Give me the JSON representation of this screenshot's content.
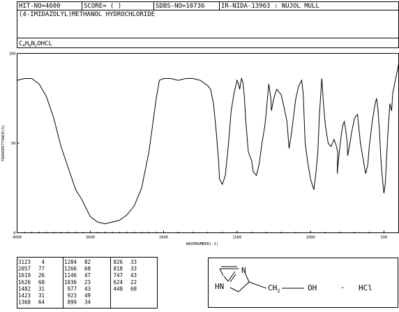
{
  "header": {
    "hit_no": "HIT-NO=4600",
    "score": "SCORE=  (   )",
    "sdbs_no": "SDBS-NO=10736",
    "method": "IR-NIDA-13963 : NUJOL MULL",
    "compound_name": "(4-IMIDAZOLYL)METHANOL HYDROCHLORIDE",
    "formula_prefix": "C",
    "formula_sub1": "4",
    "formula_mid1": "H",
    "formula_sub2": "8",
    "formula_mid2": "N",
    "formula_sub3": "2",
    "formula_mid3": "O",
    "formula_suffix": "HCL"
  },
  "chart_data": {
    "type": "line",
    "xlabel": "WAVENUMBER(-1)",
    "ylabel": "TRANSMITTANCE(%)",
    "x_reversed": true,
    "xlim": [
      4000,
      400
    ],
    "ylim": [
      0,
      100
    ],
    "x_ticks": [
      "4000",
      "3000",
      "2000",
      "1500",
      "1000",
      "500"
    ],
    "y_ticks": [
      "100",
      "50",
      "0"
    ],
    "series": [
      {
        "x": [
          4000,
          3900,
          3800,
          3700,
          3600,
          3500,
          3400,
          3300,
          3200,
          3123,
          3050,
          3000,
          2900,
          2800,
          2700,
          2600,
          2500,
          2400,
          2300,
          2200,
          2100,
          2057,
          2000,
          1950,
          1900,
          1850,
          1800,
          1750,
          1700,
          1680,
          1660,
          1640,
          1626,
          1619,
          1600,
          1580,
          1560,
          1540,
          1520,
          1500,
          1490,
          1482,
          1470,
          1460,
          1450,
          1440,
          1423,
          1400,
          1390,
          1368,
          1350,
          1330,
          1310,
          1300,
          1284,
          1270,
          1266,
          1250,
          1230,
          1200,
          1180,
          1160,
          1146,
          1130,
          1100,
          1080,
          1060,
          1050,
          1036,
          1020,
          1000,
          985,
          977,
          965,
          950,
          940,
          923,
          910,
          899,
          880,
          860,
          840,
          826,
          815,
          818,
          810,
          800,
          790,
          780,
          770,
          760,
          750,
          747,
          735,
          720,
          700,
          680,
          660,
          640,
          624,
          610,
          600,
          580,
          560,
          550,
          540,
          530,
          520,
          510,
          500,
          490,
          480,
          470,
          460,
          448,
          440,
          430,
          420,
          410,
          400
        ],
        "y": [
          85,
          86,
          86,
          83,
          76,
          64,
          48,
          36,
          24,
          19,
          13,
          9,
          6,
          5,
          6,
          7,
          10,
          15,
          25,
          45,
          75,
          85,
          86,
          86,
          85,
          86,
          86,
          85,
          82,
          80,
          72,
          55,
          40,
          30,
          27,
          32,
          48,
          68,
          78,
          85,
          83,
          80,
          86,
          84,
          76,
          62,
          45,
          40,
          34,
          32,
          38,
          50,
          60,
          68,
          83,
          75,
          68,
          75,
          80,
          77,
          70,
          62,
          47,
          55,
          75,
          82,
          85,
          78,
          50,
          40,
          30,
          26,
          24,
          32,
          45,
          65,
          86,
          70,
          60,
          50,
          48,
          52,
          49,
          45,
          33,
          40,
          48,
          55,
          60,
          62,
          57,
          50,
          43,
          48,
          56,
          64,
          66,
          50,
          40,
          33,
          38,
          48,
          62,
          72,
          75,
          68,
          56,
          40,
          30,
          22,
          28,
          45,
          60,
          72,
          68,
          78,
          82,
          86,
          90,
          94
        ],
        "interpolated": true
      }
    ],
    "peak_table": [
      [
        "3123",
        "4",
        "1284",
        "82",
        "826",
        "33"
      ],
      [
        "2057",
        "77",
        "1266",
        "68",
        "818",
        "33"
      ],
      [
        "1619",
        "26",
        "1146",
        "47",
        "747",
        "43"
      ],
      [
        "1626",
        "60",
        "1036",
        "23",
        "624",
        "22"
      ],
      [
        "1482",
        "31",
        "977",
        "43",
        "448",
        "68"
      ],
      [
        "1423",
        "31",
        "923",
        "49",
        "",
        ""
      ],
      [
        "1368",
        "64",
        "899",
        "34",
        "",
        ""
      ]
    ]
  },
  "structure": {
    "ring_n": "N",
    "ring_hn": "HN",
    "ch2_c": "CH",
    "ch2_sub": "2",
    "oh": "OH",
    "dot": "·",
    "hcl": "HCl"
  }
}
